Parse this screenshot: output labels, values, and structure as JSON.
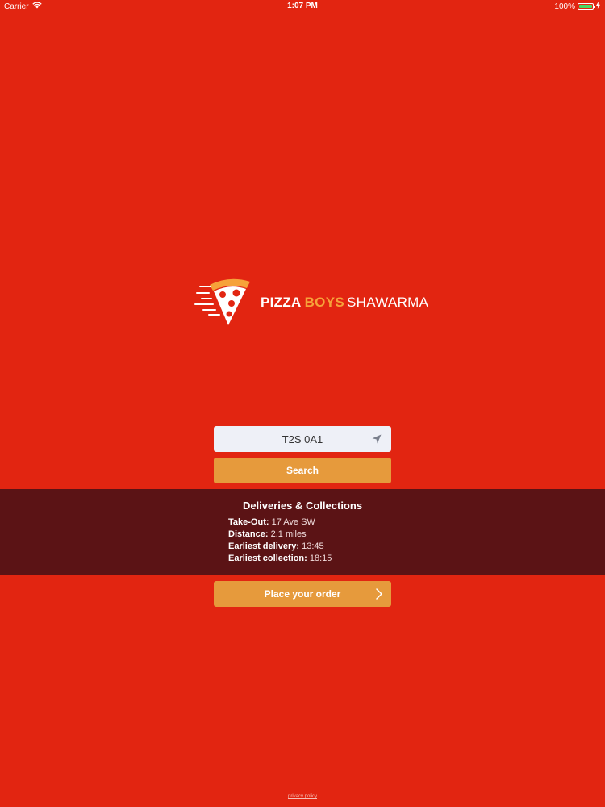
{
  "status_bar": {
    "carrier": "Carrier",
    "time": "1:07 PM",
    "battery": "100%",
    "battery_color": "#4cd964"
  },
  "logo": {
    "word1": "PIZZA",
    "word2": "BOYS",
    "word3": "SHAWARMA",
    "icon": "pizza-slice-icon",
    "accent": "#f6a23a"
  },
  "search": {
    "postcode_value": "T2S 0A1",
    "locate_icon": "location-arrow-icon",
    "button_label": "Search"
  },
  "info": {
    "title": "Deliveries & Collections",
    "rows": [
      {
        "label": "Take-Out:",
        "value": "17 Ave SW"
      },
      {
        "label": "Distance:",
        "value": "2.1 miles"
      },
      {
        "label": "Earliest delivery:",
        "value": "13:45"
      },
      {
        "label": "Earliest collection:",
        "value": "18:15"
      }
    ]
  },
  "order": {
    "button_label": "Place your order",
    "chevron_icon": "chevron-right-icon"
  },
  "footer": {
    "privacy_label": "privacy policy"
  },
  "colors": {
    "background": "#e22511",
    "panel": "#5b1315",
    "button": "#e69a3c",
    "field": "#eef0f7"
  }
}
